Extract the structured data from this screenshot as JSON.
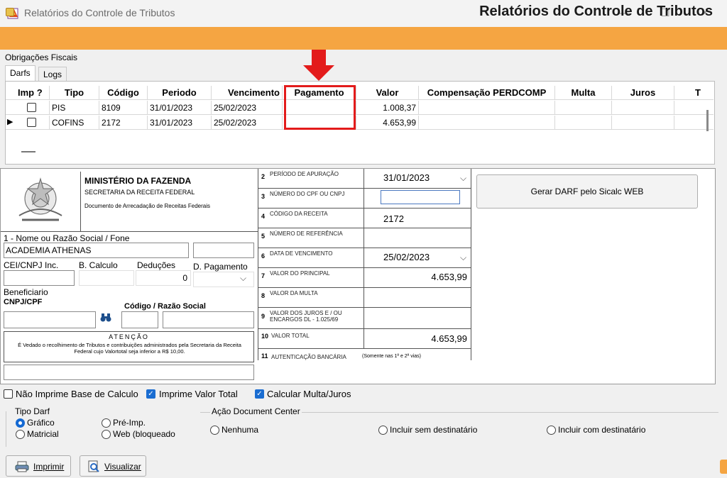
{
  "window": {
    "title": "Relatórios do Controle de Tributos",
    "minimize": "—",
    "maximize": "☐",
    "close": "✕"
  },
  "banner": {
    "title": "Relatórios do Controle de Tributos"
  },
  "section_title": "Obrigações Fiscais",
  "tabs": [
    {
      "label": "Darfs"
    },
    {
      "label": "Logs"
    }
  ],
  "grid": {
    "headers": {
      "imp": "Imp ?",
      "tipo": "Tipo",
      "codigo": "Código",
      "periodo": "Periodo",
      "vencimento": "Vencimento",
      "pagamento": "Pagamento",
      "valor": "Valor",
      "compensacao": "Compensação PERDCOMP",
      "multa": "Multa",
      "juros": "Juros",
      "extra": "T"
    },
    "rows": [
      {
        "tipo": "PIS",
        "codigo": "8109",
        "periodo": "31/01/2023",
        "vencimento": "25/02/2023",
        "pagamento": "",
        "valor": "1.008,37"
      },
      {
        "tipo": "COFINS",
        "codigo": "2172",
        "periodo": "31/01/2023",
        "vencimento": "25/02/2023",
        "pagamento": "",
        "valor": "4.653,99"
      }
    ],
    "current_row_marker": "▶"
  },
  "darf": {
    "ministerio": "MINISTÉRIO DA FAZENDA",
    "secretaria": "SECRETARIA DA RECEITA FEDERAL",
    "documento": "Documento de Arrecadação de Receitas Federais",
    "nome_label": "1 - Nome ou Razão Social / Fone",
    "nome_value": "ACADEMIA ATHENAS",
    "cei_label": "CEI/CNPJ Inc.",
    "calculo_label": "B. Calculo",
    "deducoes_label": "Deduções",
    "deducoes_value": "0",
    "dpagamento_label": "D. Pagamento",
    "beneficiario_label": "Beneficiario",
    "cnpjcpf_label": "CNPJ/CPF",
    "codigo_razao_label": "Código  /  Razão Social",
    "atencao_title": "ATENÇÃO",
    "atencao_text": "É Vedado o recolhimento de Tributos e contribuições administrados pela Secretaria da Receita Federal cujo Valortotal seja inferior a R$ 10,00.",
    "fields": {
      "f2": {
        "num": "2",
        "label": "PERÍODO DE APURAÇÃO",
        "value": "31/01/2023"
      },
      "f3": {
        "num": "3",
        "label": "NÚMERO DO CPF OU CNPJ",
        "value": ""
      },
      "f4": {
        "num": "4",
        "label": "CÓDIGO DA RECEITA",
        "value": "2172"
      },
      "f5": {
        "num": "5",
        "label": "NÚMERO DE REFERÊNCIA",
        "value": ""
      },
      "f6": {
        "num": "6",
        "label": "DATA DE VENCIMENTO",
        "value": "25/02/2023"
      },
      "f7": {
        "num": "7",
        "label": "VALOR DO PRINCIPAL",
        "value": "4.653,99"
      },
      "f8": {
        "num": "8",
        "label": "VALOR DA MULTA",
        "value": ""
      },
      "f9": {
        "num": "9",
        "label": "VALOR DOS JUROS E / OU ENCARGOS DL - 1.025/69",
        "value": ""
      },
      "f10": {
        "num": "10",
        "label": "VALOR TOTAL",
        "value": "4.653,99"
      },
      "f11": {
        "num": "11",
        "label": "AUTENTICAÇÃO BANCÁRIA",
        "sub": "(Somente nas 1ª e 2ª vias)"
      }
    },
    "gerar_button": "Gerar DARF pelo Sicalc WEB"
  },
  "options": {
    "nao_imprime": "Não Imprime Base de Calculo",
    "imprime_valor": "Imprime Valor Total",
    "calcular": "Calcular Multa/Juros"
  },
  "tipo_darf": {
    "title": "Tipo Darf",
    "grafico": "Gráfico",
    "matricial": "Matricial",
    "preimp": "Pré-Imp.",
    "web": "Web (bloqueado"
  },
  "acao": {
    "title": "Ação Document Center",
    "nenhuma": "Nenhuma",
    "sem": "Incluir sem destinatário",
    "com": "Incluir com destinatário"
  },
  "buttons": {
    "imprimir": "Imprimir",
    "visualizar": "Visualizar"
  },
  "colors": {
    "banner": "#f5a542",
    "highlight": "#e31b1b",
    "arrow": "#e31b1b",
    "checked": "#1a6dd1"
  }
}
